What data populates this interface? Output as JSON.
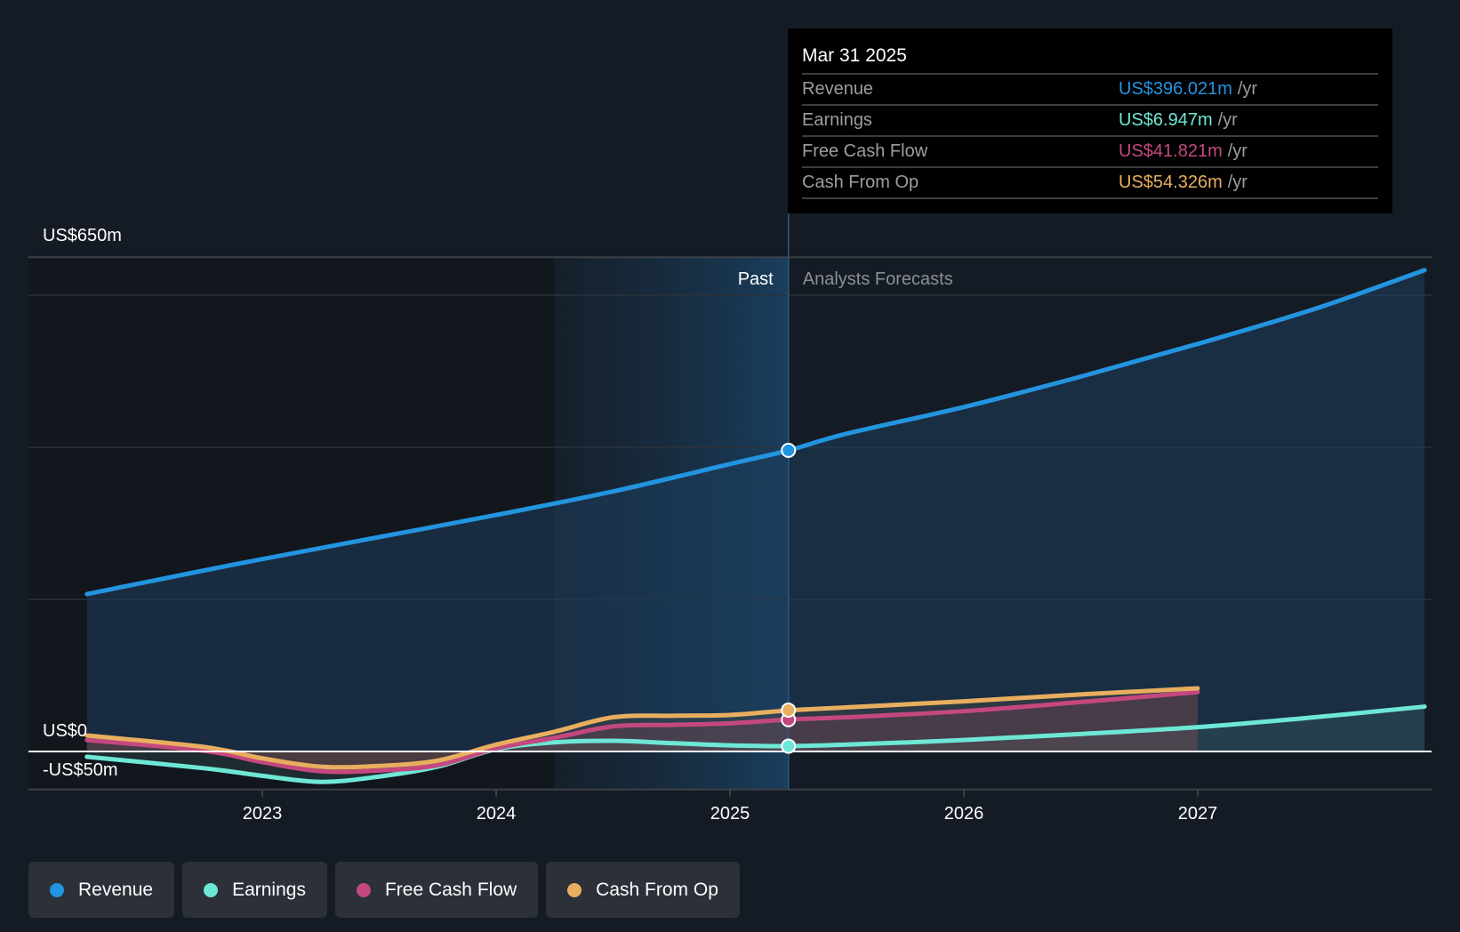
{
  "chart_data": {
    "type": "line",
    "title": "",
    "xlabel": "",
    "ylabel": "",
    "ylim": [
      -50,
      650
    ],
    "y_tick_labels": [
      {
        "value": 650,
        "label": "US$650m"
      },
      {
        "value": 0,
        "label": "US$0"
      },
      {
        "value": -50,
        "label": "-US$50m"
      }
    ],
    "y_gridlines": [
      600,
      400,
      200
    ],
    "xlim": [
      2022.0,
      2028.0
    ],
    "x_ticks": [
      {
        "value": 2023,
        "label": "2023"
      },
      {
        "value": 2024,
        "label": "2024"
      },
      {
        "value": 2025,
        "label": "2025"
      },
      {
        "value": 2026,
        "label": "2026"
      },
      {
        "value": 2027,
        "label": "2027"
      }
    ],
    "past_region": {
      "start": 2024.25,
      "end": 2025.25,
      "label": "Past"
    },
    "forecast_label": "Analysts Forecasts",
    "cursor_x": 2025.25,
    "legend_position": "bottom-left",
    "series": [
      {
        "name": "Revenue",
        "color": "#2394df",
        "x": [
          2022.25,
          2022.75,
          2023.0,
          2023.5,
          2024.0,
          2024.5,
          2025.0,
          2025.25,
          2025.5,
          2026.0,
          2026.5,
          2027.0,
          2027.5,
          2027.97
        ],
        "values": [
          207,
          238,
          253,
          282,
          311,
          342,
          378,
          396,
          418,
          453,
          493,
          536,
          582,
          633
        ]
      },
      {
        "name": "Earnings",
        "color": "#6ee7d6",
        "x": [
          2022.25,
          2022.75,
          2023.0,
          2023.25,
          2023.5,
          2023.75,
          2024.0,
          2024.25,
          2024.5,
          2024.75,
          2025.0,
          2025.25,
          2025.5,
          2026.0,
          2026.5,
          2027.0,
          2027.5,
          2027.97
        ],
        "values": [
          -7,
          -22,
          -32,
          -40,
          -33,
          -20,
          3,
          12,
          14,
          11,
          8,
          7,
          9,
          15,
          23,
          32,
          45,
          59
        ]
      },
      {
        "name": "Free Cash Flow",
        "color": "#c4487f",
        "x": [
          2022.25,
          2022.75,
          2023.0,
          2023.25,
          2023.5,
          2023.75,
          2024.0,
          2024.25,
          2024.5,
          2024.75,
          2025.0,
          2025.25,
          2025.5,
          2026.0,
          2026.5,
          2027.0
        ],
        "values": [
          15,
          1,
          -14,
          -26,
          -25,
          -18,
          4,
          18,
          33,
          35,
          37,
          42,
          45,
          53,
          65,
          78
        ]
      },
      {
        "name": "Cash From Op",
        "color": "#e8ae5f",
        "x": [
          2022.25,
          2022.75,
          2023.0,
          2023.25,
          2023.5,
          2023.75,
          2024.0,
          2024.25,
          2024.5,
          2024.75,
          2025.0,
          2025.25,
          2025.5,
          2026.0,
          2026.5,
          2027.0
        ],
        "values": [
          21,
          6,
          -9,
          -20,
          -19,
          -12,
          9,
          26,
          45,
          47,
          48,
          54,
          58,
          66,
          75,
          83
        ]
      }
    ]
  },
  "tooltip": {
    "date": "Mar 31 2025",
    "rows": [
      {
        "label": "Revenue",
        "value": "US$396.021m",
        "unit": "/yr",
        "color": "#2394df"
      },
      {
        "label": "Earnings",
        "value": "US$6.947m",
        "unit": "/yr",
        "color": "#6ee7d6"
      },
      {
        "label": "Free Cash Flow",
        "value": "US$41.821m",
        "unit": "/yr",
        "color": "#c4487f"
      },
      {
        "label": "Cash From Op",
        "value": "US$54.326m",
        "unit": "/yr",
        "color": "#e8ae5f"
      }
    ]
  },
  "legend": [
    {
      "label": "Revenue",
      "color": "#2394df"
    },
    {
      "label": "Earnings",
      "color": "#6ee7d6"
    },
    {
      "label": "Free Cash Flow",
      "color": "#c4487f"
    },
    {
      "label": "Cash From Op",
      "color": "#e8ae5f"
    }
  ]
}
